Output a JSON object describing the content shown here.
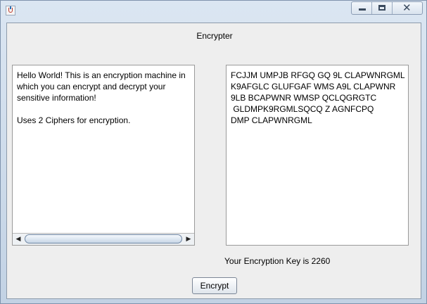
{
  "window": {
    "title": "",
    "controls": [
      "minimize",
      "maximize",
      "close"
    ]
  },
  "main": {
    "heading": "Encrypter",
    "input_text": "Hello World! This is an encryption machine in which you can encrypt and decrypt your sensitive information!\n\nUses 2 Ciphers for encryption.",
    "output_text": "FCJJM UMPJB RFGQ GQ 9L CLAPWNRGML\nK9AFGLC GLUFGAF WMS A9L CLAPWNR\n9LB BCAPWNR WMSP QCLQGRGTC\n GLDMPK9RGMLSQCQ Z AGNFCPQ\nDMP CLAPWNRGML",
    "key_label": "Your Encryption Key is 2260",
    "encrypt_label": "Encrypt"
  }
}
